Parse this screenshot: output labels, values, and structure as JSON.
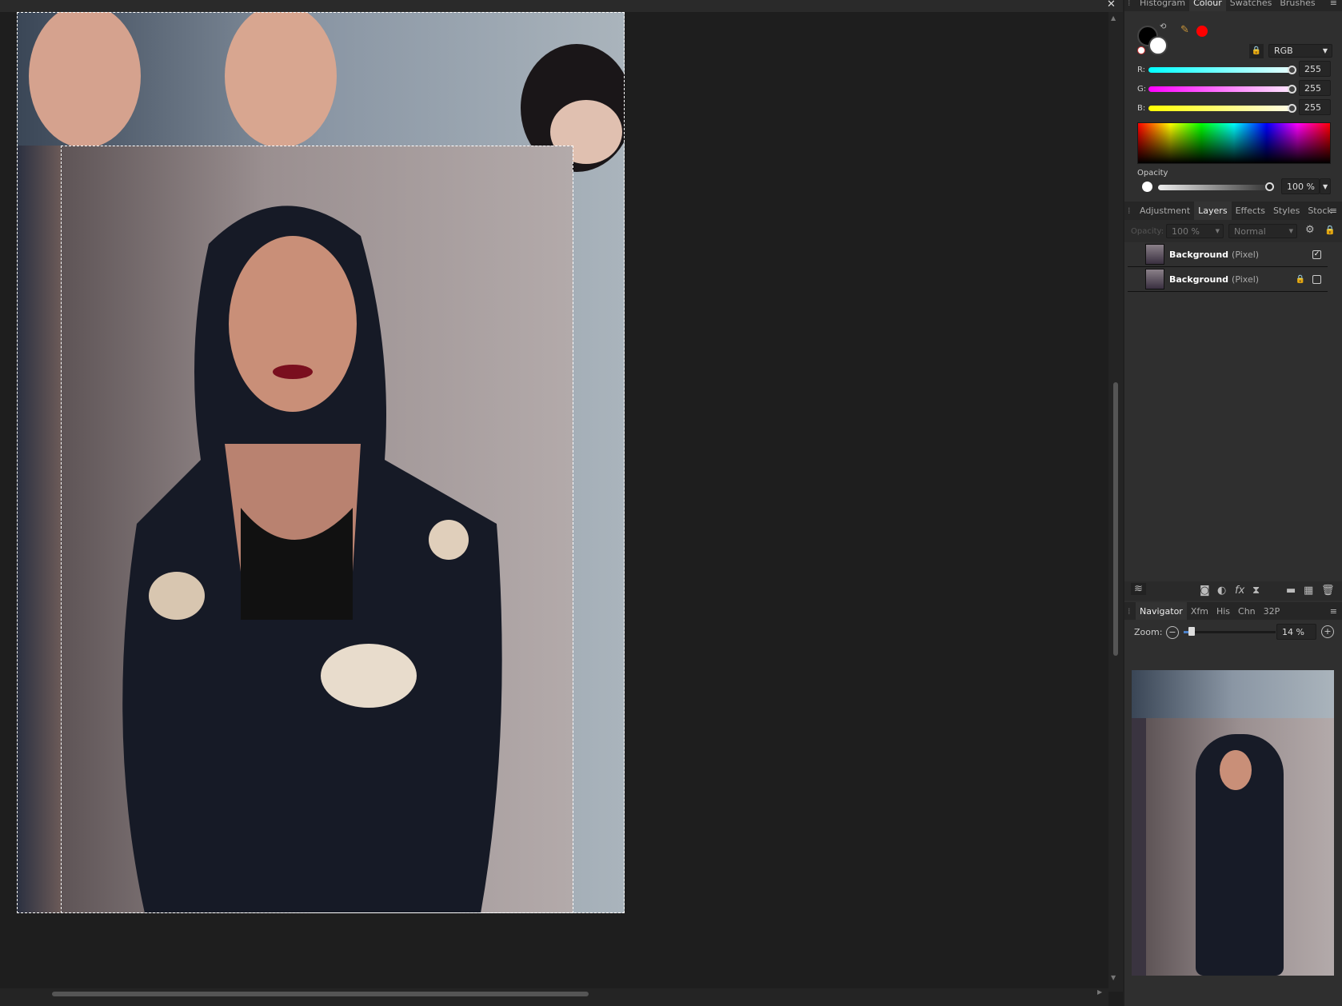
{
  "window": {
    "close_icon": "close-icon"
  },
  "colour_panel": {
    "tabs": [
      "Histogram",
      "Colour",
      "Swatches",
      "Brushes"
    ],
    "active_tab": "Colour",
    "mode": "RGB",
    "channels": [
      {
        "label": "R:",
        "value": "255"
      },
      {
        "label": "G:",
        "value": "255"
      },
      {
        "label": "B:",
        "value": "255"
      }
    ],
    "opacity_label": "Opacity",
    "opacity_value": "100 %",
    "primary_color": "#000000",
    "secondary_color": "#ffffff",
    "picked_color": "#ff0000"
  },
  "layers_panel": {
    "tabs": [
      "Adjustment",
      "Layers",
      "Effects",
      "Styles",
      "Stock"
    ],
    "active_tab": "Layers",
    "opacity_label": "Opacity:",
    "opacity_value": "100 %",
    "blend_mode": "Normal",
    "layers": [
      {
        "name": "Background",
        "type": "(Pixel)",
        "visible": true,
        "locked": false
      },
      {
        "name": "Background",
        "type": "(Pixel)",
        "visible": false,
        "locked": true
      }
    ]
  },
  "navigator_panel": {
    "tabs": [
      "Navigator",
      "Xfm",
      "His",
      "Chn",
      "32P"
    ],
    "active_tab": "Navigator",
    "zoom_label": "Zoom:",
    "zoom_value": "14 %"
  }
}
